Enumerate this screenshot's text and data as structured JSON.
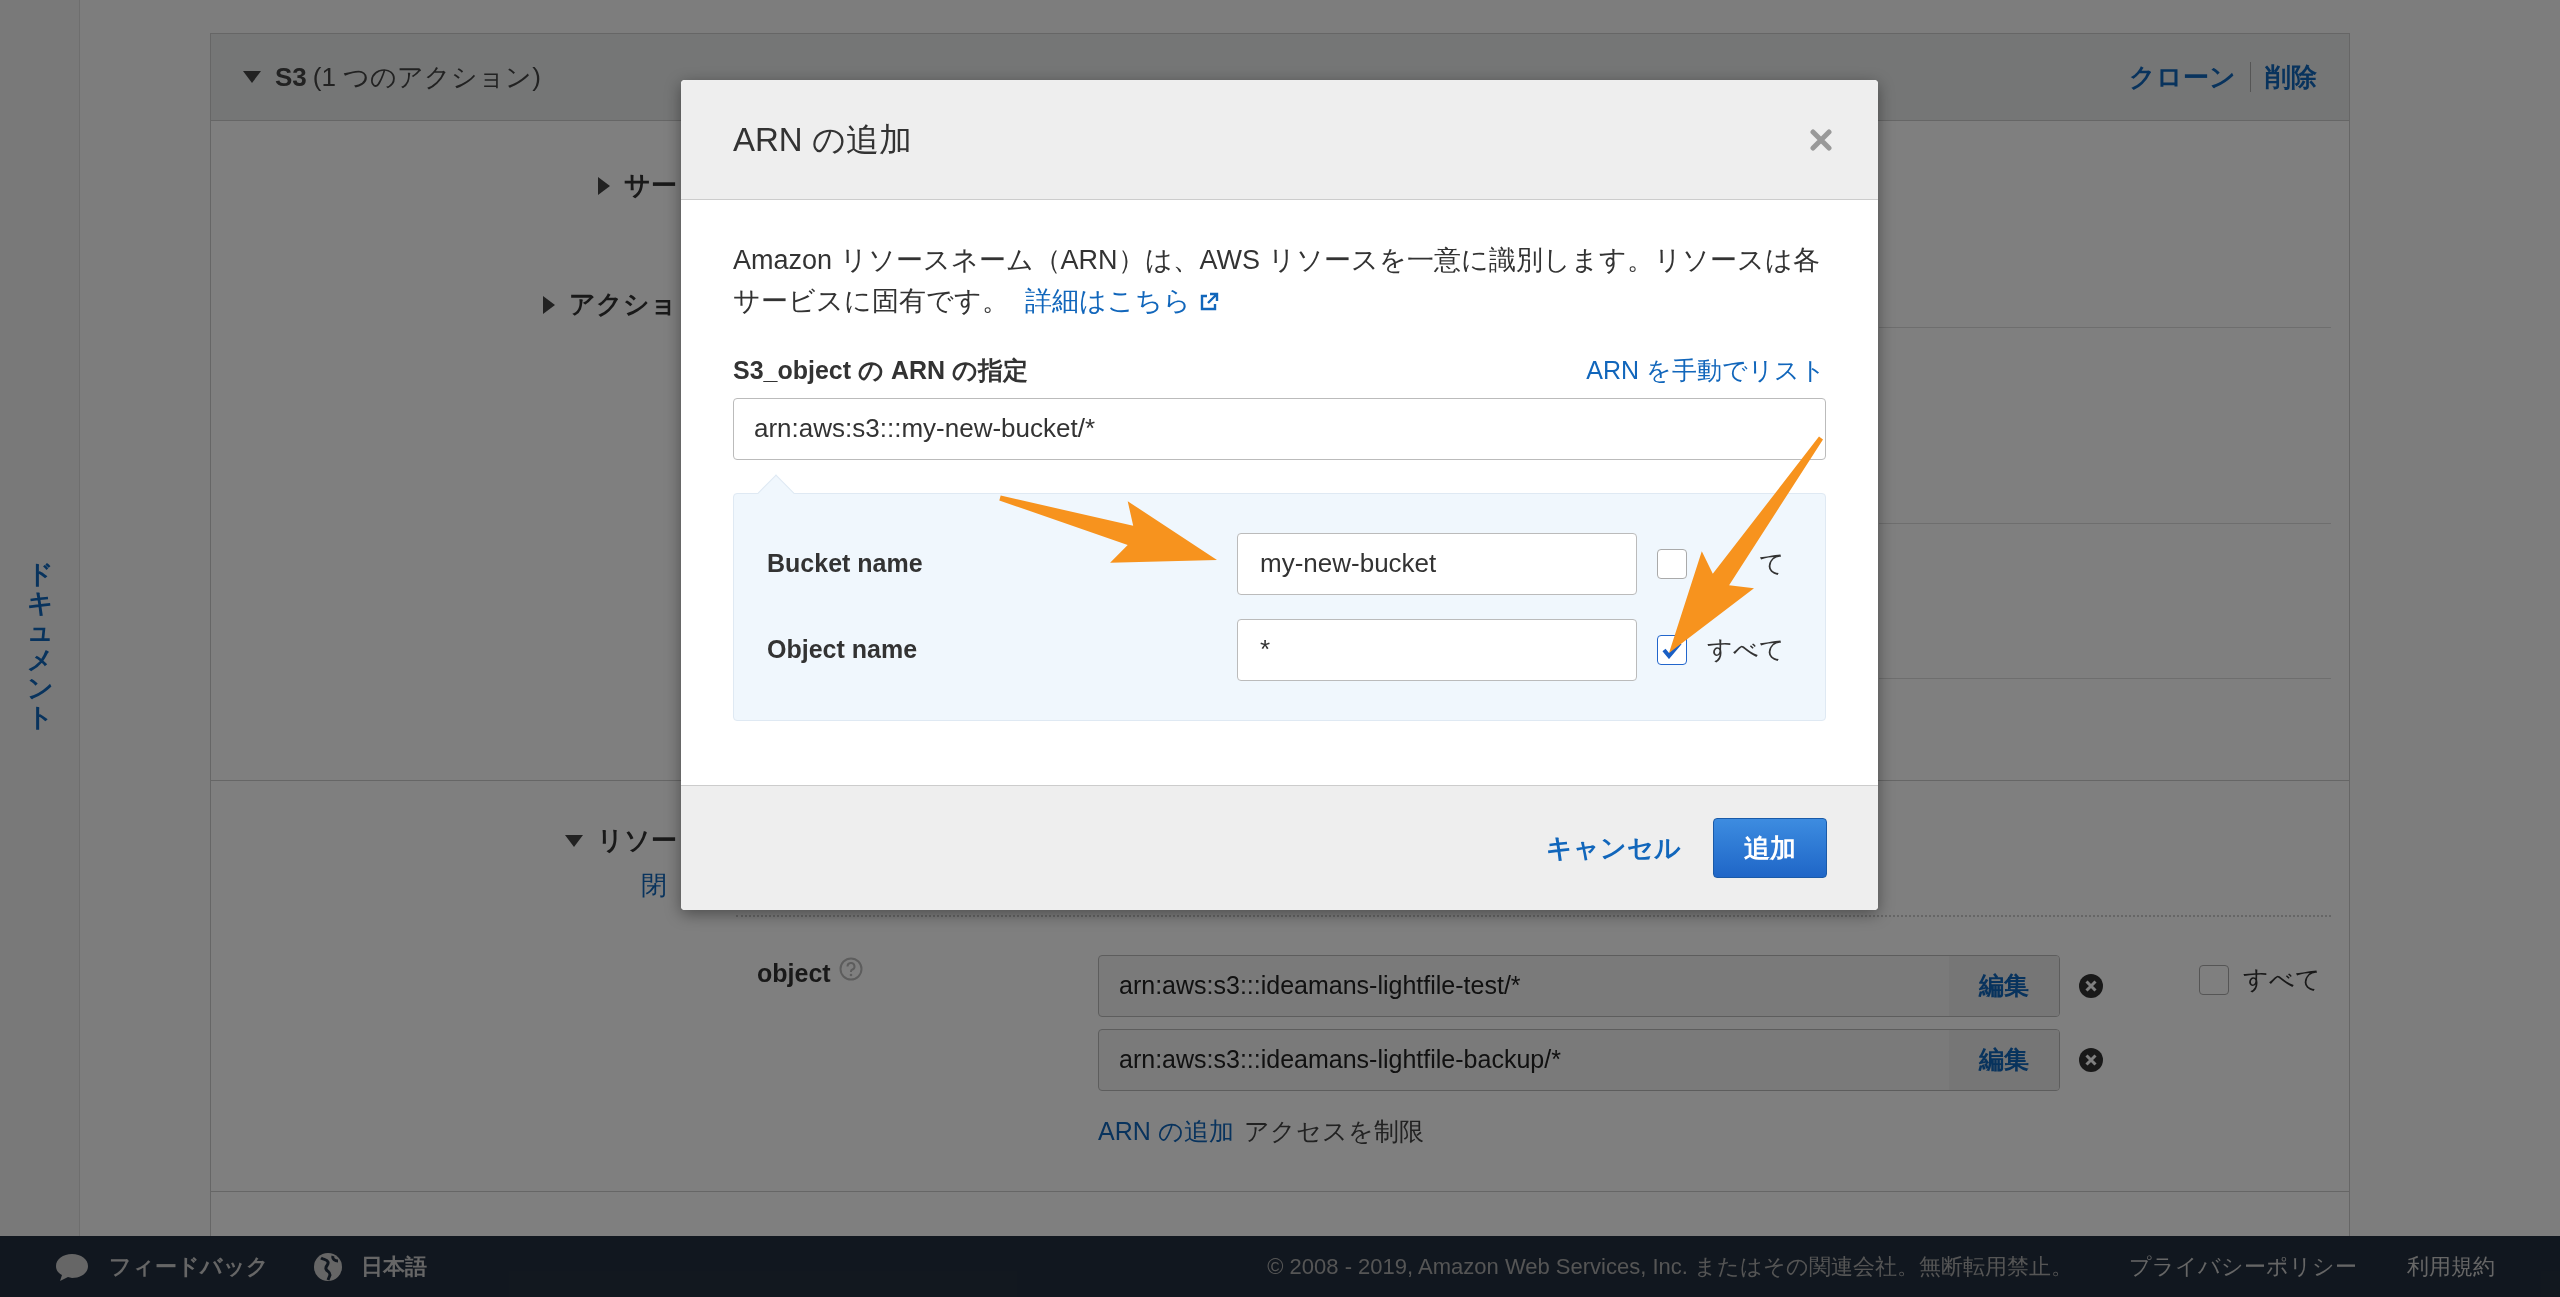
{
  "sidebar": {
    "label": "ドキュメント"
  },
  "policy_panel": {
    "service": "S3",
    "action_count": "(1 つのアクション)",
    "header_links": [
      "クローン",
      "削除"
    ],
    "sections": [
      {
        "label": "サー",
        "expanded": false
      },
      {
        "label": "アクショ",
        "expanded": false
      },
      {
        "label": "リソー",
        "expanded": true,
        "sub_link": "閉"
      }
    ],
    "resources": {
      "label": "object",
      "arns": [
        {
          "value": "arn:aws:s3:::ideamans-lightfile-test/*",
          "edit": "編集"
        },
        {
          "value": "arn:aws:s3:::ideamans-lightfile-backup/*",
          "edit": "編集"
        }
      ],
      "all": {
        "label": "すべて",
        "checked": false
      },
      "add_link": "ARN の追加",
      "restrict_text": "アクセスを制限"
    }
  },
  "modal": {
    "title": "ARN の追加",
    "description": "Amazon リソースネーム（ARN）は、AWS リソースを一意に識別します。リソースは各サービスに固有です。",
    "learn_more": "詳細はこちら",
    "field_label": "S3_object の ARN の指定",
    "manual_link": "ARN を手動でリスト",
    "arn_value": "arn:aws:s3:::my-new-bucket/*",
    "parts": [
      {
        "label": "Bucket name",
        "value": "my-new-bucket",
        "all_label": "て",
        "all_checked": false
      },
      {
        "label": "Object name",
        "value": "*",
        "all_label": "すべて",
        "all_checked": true
      }
    ],
    "cancel": "キャンセル",
    "add": "追加"
  },
  "footer": {
    "feedback": "フィードバック",
    "language": "日本語",
    "copyright": "© 2008 - 2019, Amazon Web Services, Inc. またはその関連会社。無断転用禁止。",
    "links": [
      "プライバシーポリシー",
      "利用規約"
    ]
  }
}
